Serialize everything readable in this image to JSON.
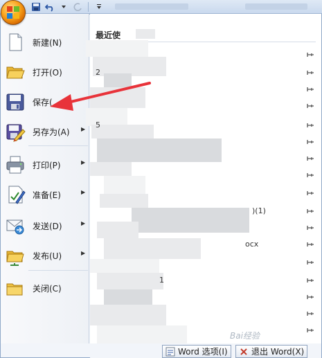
{
  "menu": {
    "items": [
      {
        "label": "新建(N)",
        "has_arrow": false
      },
      {
        "label": "打开(O)",
        "has_arrow": false
      },
      {
        "label": "保存(",
        "has_arrow": false
      },
      {
        "label": "另存为(A)",
        "has_arrow": true
      },
      {
        "label": "打印(P)",
        "has_arrow": true
      },
      {
        "label": "准备(E)",
        "has_arrow": true
      },
      {
        "label": "发送(D)",
        "has_arrow": true
      },
      {
        "label": "发布(U)",
        "has_arrow": true
      },
      {
        "label": "关闭(C)",
        "has_arrow": false
      }
    ]
  },
  "recent": {
    "title": "最近使",
    "rows": [
      {
        "num": "",
        "name": ""
      },
      {
        "num": "2",
        "name": ""
      },
      {
        "num": "",
        "name": ""
      },
      {
        "num": "",
        "name": ""
      },
      {
        "num": "5",
        "name": ""
      },
      {
        "num": "",
        "name": ""
      },
      {
        "num": "",
        "name": ""
      },
      {
        "num": "",
        "name": ""
      },
      {
        "num": "",
        "name": ""
      },
      {
        "num": "",
        "name": ")(1)"
      },
      {
        "num": "",
        "name": ""
      },
      {
        "num": "",
        "name": "ocx"
      },
      {
        "num": "",
        "name": ""
      },
      {
        "num": "",
        "name": "1"
      },
      {
        "num": "",
        "name": ""
      },
      {
        "num": "",
        "name": ""
      },
      {
        "num": "",
        "name": ""
      },
      {
        "num": "",
        "name": ""
      },
      {
        "num": "",
        "name": ""
      },
      {
        "num": "",
        "name": ""
      }
    ]
  },
  "bottom": {
    "options_label": "Word 选项(I)",
    "exit_label": "退出 Word(X)"
  },
  "watermark": "Bai经验",
  "colors": {
    "annotation_arrow": "#e8333a",
    "panel_bg": "#f2f5fa",
    "titlebar": "#dfe9f5"
  }
}
